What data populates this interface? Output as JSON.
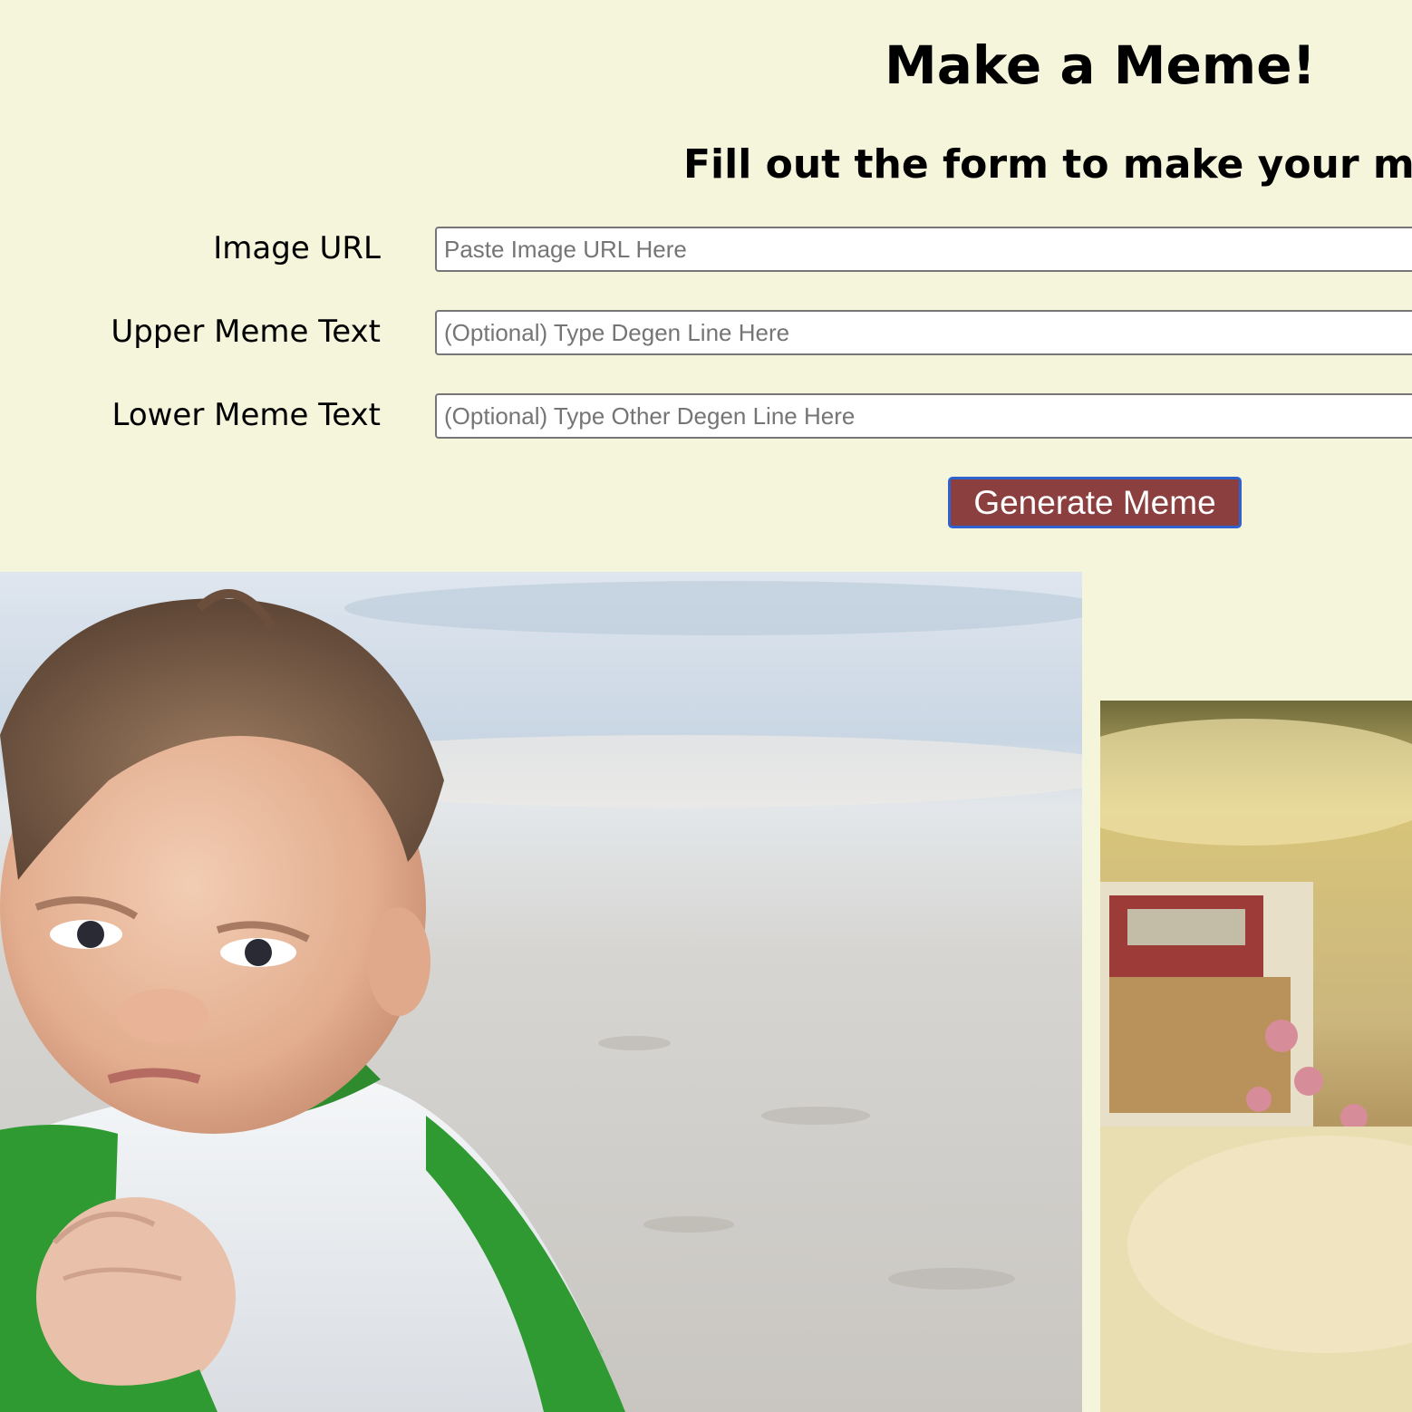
{
  "header": {
    "title": "Make a Meme!",
    "subtitle": "Fill out the form to make your m"
  },
  "form": {
    "image_url": {
      "label": "Image URL",
      "placeholder": "Paste Image URL Here",
      "value": ""
    },
    "upper_text": {
      "label": "Upper Meme Text",
      "placeholder": "(Optional) Type Degen Line Here",
      "value": ""
    },
    "lower_text": {
      "label": "Lower Meme Text",
      "placeholder": "(Optional) Type Other Degen Line Here",
      "value": ""
    },
    "submit_label": "Generate Meme"
  },
  "colors": {
    "page_background": "#f5f5dc",
    "button_background": "#8b3f3f",
    "button_border": "#2f62cf"
  },
  "memes": [
    {
      "subject": "success-kid-beach-photo"
    },
    {
      "subject": "blurred-room-photo"
    }
  ]
}
